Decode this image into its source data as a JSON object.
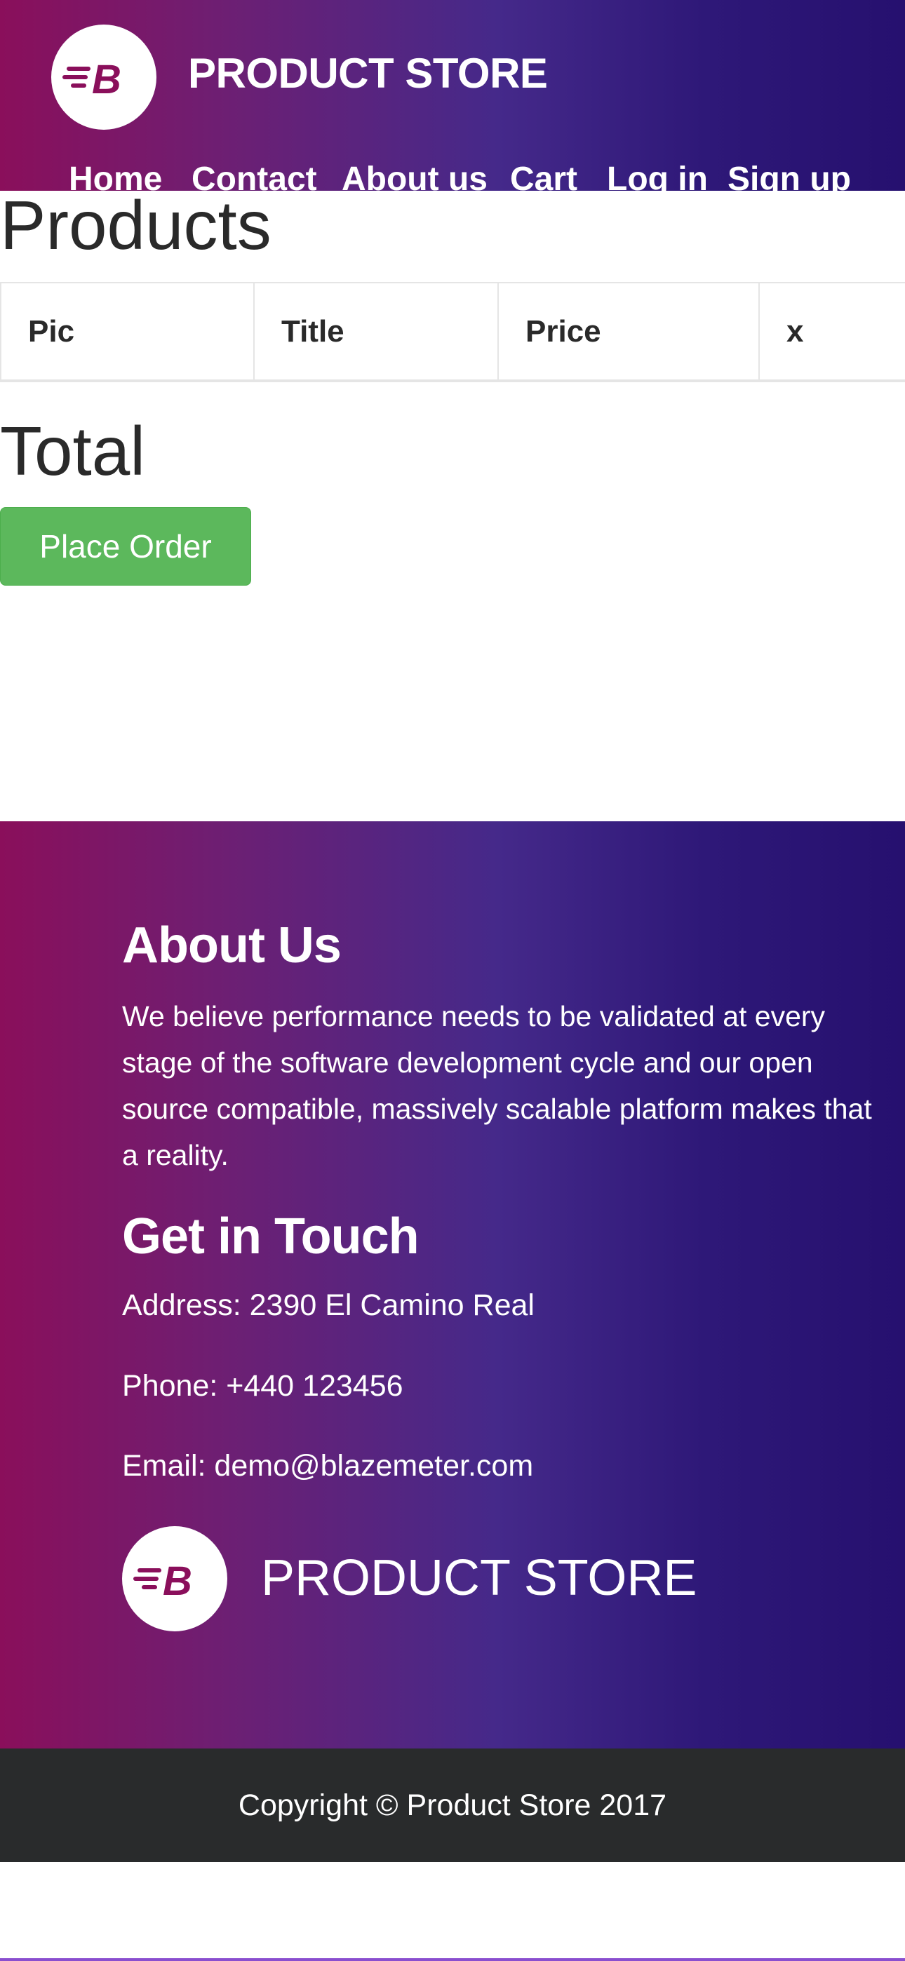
{
  "navbar": {
    "logo_icon": "blazemeter-b-logo",
    "brand": "PRODUCT STORE",
    "links": [
      {
        "label": "Home"
      },
      {
        "label": "Contact"
      },
      {
        "label": "About us"
      },
      {
        "label": "Cart"
      },
      {
        "label": "Log in"
      },
      {
        "label": "Sign up"
      }
    ]
  },
  "main": {
    "title": "Products",
    "table": {
      "headers": [
        "Pic",
        "Title",
        "Price",
        "x"
      ],
      "rows": []
    },
    "total_label": "Total",
    "place_order_label": "Place Order"
  },
  "footer": {
    "about_heading": "About Us",
    "about_text": "We believe performance needs to be validated at every stage of the software development cycle and our open source compatible, massively scalable platform makes that a reality.",
    "contact_heading": "Get in Touch",
    "address": "Address: 2390 El Camino Real",
    "phone": "Phone: +440 123456",
    "email": "Email: demo@blazemeter.com",
    "logo_icon": "blazemeter-b-logo",
    "brand": "PRODUCT STORE",
    "copyright": "Copyright © Product Store 2017"
  },
  "colors": {
    "gradient_start": "#8a0f5b",
    "gradient_end": "#26106f",
    "button_green": "#5cb85c",
    "copyright_bg": "#292b2c"
  }
}
